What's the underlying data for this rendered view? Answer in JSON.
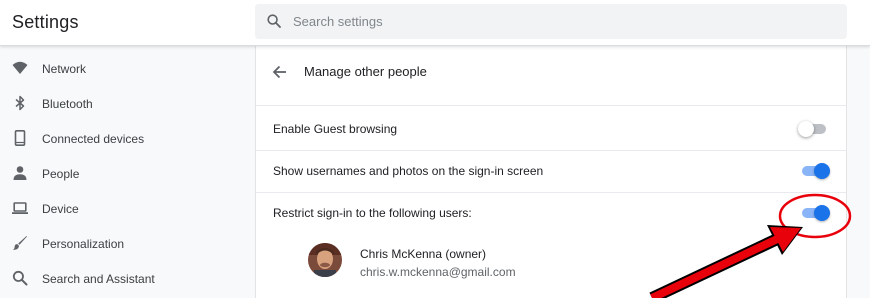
{
  "app": {
    "title": "Settings"
  },
  "search": {
    "placeholder": "Search settings",
    "icon": "search-icon"
  },
  "sidebar": {
    "items": [
      {
        "label": "Network",
        "icon": "wifi-icon"
      },
      {
        "label": "Bluetooth",
        "icon": "bluetooth-icon"
      },
      {
        "label": "Connected devices",
        "icon": "phone-icon"
      },
      {
        "label": "People",
        "icon": "person-icon"
      },
      {
        "label": "Device",
        "icon": "laptop-icon"
      },
      {
        "label": "Personalization",
        "icon": "brush-icon"
      },
      {
        "label": "Search and Assistant",
        "icon": "search-icon"
      }
    ]
  },
  "page": {
    "title": "Manage other people",
    "back_icon": "arrow-back-icon",
    "settings": [
      {
        "label": "Enable Guest browsing",
        "enabled": false
      },
      {
        "label": "Show usernames and photos on the sign-in screen",
        "enabled": true
      },
      {
        "label": "Restrict sign-in to the following users:",
        "enabled": true
      }
    ],
    "users": [
      {
        "name": "Chris McKenna (owner)",
        "email": "chris.w.mckenna@gmail.com"
      }
    ]
  },
  "annotation": {
    "shape": "red circle and arrow pointing at restrict sign-in toggle",
    "color": "#e8000b"
  },
  "colors": {
    "toggle_on": "#1a73e8",
    "toggle_on_track": "#8ab4f8",
    "toggle_off_track": "#bdc1c6",
    "annotation": "#e8000b"
  }
}
